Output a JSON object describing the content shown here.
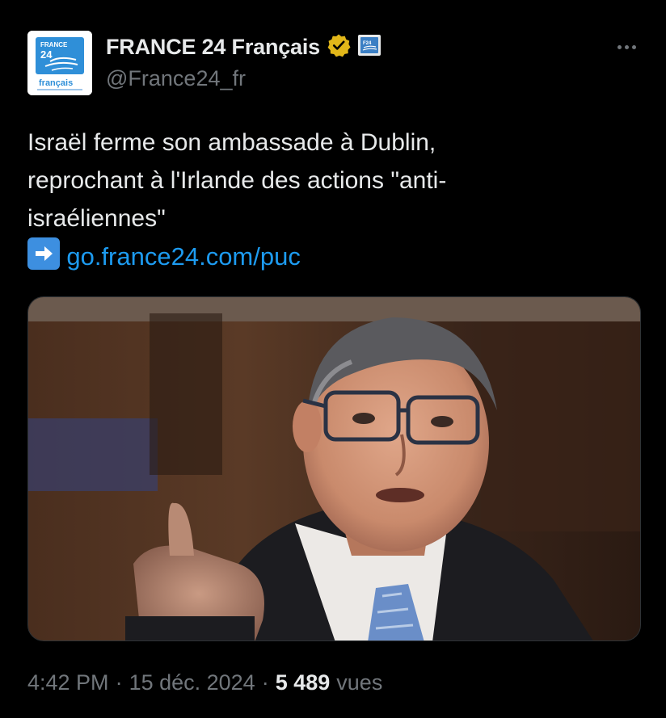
{
  "author": {
    "display_name": "FRANCE 24 Français",
    "handle": "@France24_fr",
    "avatar": {
      "logo_line1": "FRANCE",
      "logo_line2": "24",
      "logo_line3": "français"
    },
    "verified_badge_color": "#e2b719",
    "affiliate_badge_color": "#3b7fc4"
  },
  "tweet": {
    "text_lines": [
      "Israël ferme son ambassade à Dublin,",
      "reprochant à l'Irlande des actions \"anti-",
      "israéliennes\""
    ],
    "link_prefix_icon": "right-arrow-emoji-icon",
    "link_text": "go.france24.com/puc",
    "link_color": "#1d9bf0"
  },
  "media": {
    "type": "photo"
  },
  "meta": {
    "time": "4:42 PM",
    "date": "15 déc. 2024",
    "views_count": "5 489",
    "views_label": "vues",
    "separator": "·"
  },
  "colors": {
    "background": "#000000",
    "primary_text": "#e7e9ea",
    "secondary_text": "#71767b"
  }
}
